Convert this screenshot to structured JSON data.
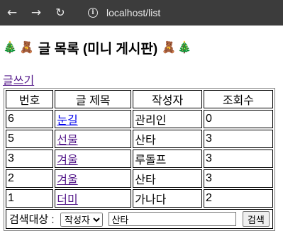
{
  "browser": {
    "url": "localhost/list"
  },
  "page": {
    "title": "글 목록 (미니 게시판)",
    "emoji_tree": "🎄",
    "emoji_bear": "🧸",
    "write_link": "글쓰기"
  },
  "table": {
    "headers": [
      "번호",
      "글 제목",
      "작성자",
      "조회수"
    ],
    "rows": [
      {
        "no": "6",
        "title": "눈길",
        "author": "관리인",
        "views": "0"
      },
      {
        "no": "5",
        "title": "선물",
        "author": "산타",
        "views": "3"
      },
      {
        "no": "3",
        "title": "겨울",
        "author": "루돌프",
        "views": "3"
      },
      {
        "no": "2",
        "title": "겨울",
        "author": "산타",
        "views": "3"
      },
      {
        "no": "1",
        "title": "더미",
        "author": "가나다",
        "views": "2"
      }
    ]
  },
  "search": {
    "label": "검색대상 :",
    "selected": "작성자",
    "value": "산타",
    "button": "검색"
  }
}
